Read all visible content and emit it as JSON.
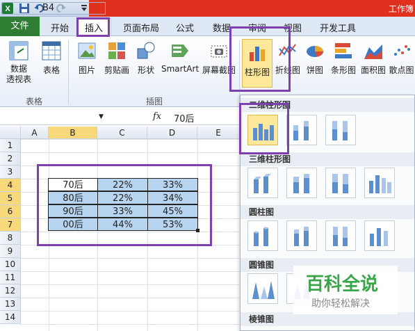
{
  "window": {
    "title": "工作簿"
  },
  "tabs": [
    "文件",
    "开始",
    "插入",
    "页面布局",
    "公式",
    "数据",
    "审阅",
    "视图",
    "开发工具"
  ],
  "ribbon": {
    "groups": [
      "表格",
      "插图"
    ],
    "buttons": [
      {
        "label": "数据\n透视表",
        "icon": "pivot-table-icon"
      },
      {
        "label": "表格",
        "icon": "table-icon"
      },
      {
        "label": "图片",
        "icon": "picture-icon"
      },
      {
        "label": "剪贴画",
        "icon": "clipart-icon"
      },
      {
        "label": "形状",
        "icon": "shapes-icon"
      },
      {
        "label": "SmartArt",
        "icon": "smartart-icon"
      },
      {
        "label": "屏幕截图",
        "icon": "screenshot-icon"
      },
      {
        "label": "柱形图",
        "icon": "column-chart-icon"
      },
      {
        "label": "折线图",
        "icon": "line-chart-icon"
      },
      {
        "label": "饼图",
        "icon": "pie-chart-icon"
      },
      {
        "label": "条形图",
        "icon": "bar-chart-icon"
      },
      {
        "label": "面积图",
        "icon": "area-chart-icon"
      },
      {
        "label": "散点图",
        "icon": "scatter-chart-icon"
      }
    ]
  },
  "formula": {
    "namebox": "B4",
    "fx": "fx",
    "value": "70后"
  },
  "columns": [
    "A",
    "B",
    "C",
    "D",
    "E"
  ],
  "rows": [
    "1",
    "2",
    "3",
    "4",
    "5",
    "6",
    "7",
    "8",
    "9",
    "10",
    "11",
    "12",
    "13",
    "14"
  ],
  "table": [
    [
      "70后",
      "22%",
      "33%"
    ],
    [
      "80后",
      "22%",
      "34%"
    ],
    [
      "90后",
      "33%",
      "45%"
    ],
    [
      "00后",
      "44%",
      "53%"
    ]
  ],
  "gallery": {
    "sections": [
      "二维柱形图",
      "三维柱形图",
      "圆柱图",
      "圆锥图",
      "棱锥图"
    ]
  },
  "watermark": {
    "brand": "百科全说",
    "slogan": "助你轻松解决"
  },
  "colors": {
    "highlight": "#7e3fb1",
    "file_tab": "#2e7d32",
    "selected": "#f7d87a",
    "cell_fill": "#b7d4f0"
  }
}
